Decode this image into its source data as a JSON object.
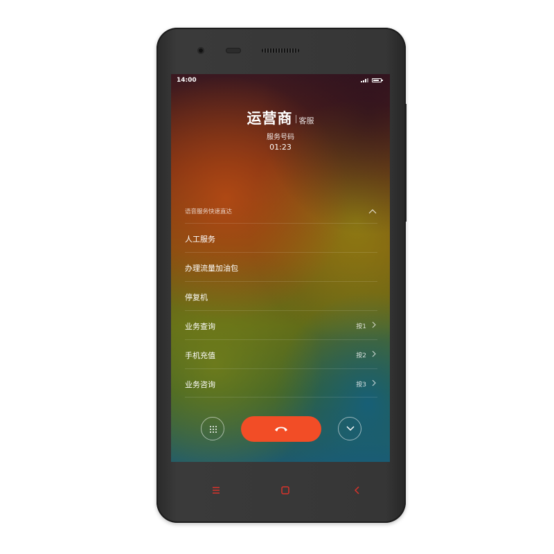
{
  "status_bar": {
    "time": "14:00",
    "battery_level": 0.8
  },
  "call": {
    "caller_name": "运营商",
    "caller_tag": "客服",
    "caller_number": "服务号码",
    "duration": "01:23"
  },
  "voice_menu": {
    "header": "语音服务快速直达",
    "items": [
      {
        "label": "人工服务",
        "key": ""
      },
      {
        "label": "办理流量加油包",
        "key": ""
      },
      {
        "label": "停复机",
        "key": ""
      },
      {
        "label": "业务查询",
        "key": "按1"
      },
      {
        "label": "手机充值",
        "key": "按2"
      },
      {
        "label": "业务咨询",
        "key": "按3"
      }
    ]
  },
  "controls": {
    "keypad_icon": "dialpad-icon",
    "hangup_icon": "phone-hangup-icon",
    "minimize_icon": "chevron-down-icon",
    "hangup_color": "#f24d26"
  },
  "hardware_keys": {
    "menu_icon": "menu-icon",
    "home_icon": "home-icon",
    "back_icon": "back-icon",
    "key_color": "#d9322a"
  }
}
